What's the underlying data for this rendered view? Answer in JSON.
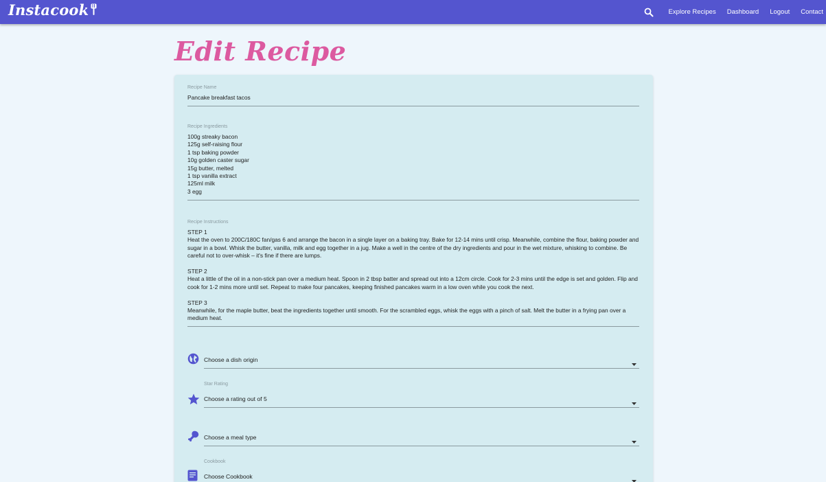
{
  "nav": {
    "brand": "Instacook",
    "links": [
      "Explore Recipes",
      "Dashboard",
      "Logout",
      "Contact"
    ]
  },
  "page": {
    "title": "Edit Recipe"
  },
  "form": {
    "name": {
      "label": "Recipe Name",
      "value": "Pancake breakfast tacos"
    },
    "ingredients": {
      "label": "Recipe Ingredients",
      "value": "100g streaky bacon\n125g self-raising flour\n1 tsp baking powder\n10g golden caster sugar\n15g butter, melted\n1 tsp vanilla extract\n125ml milk\n3 egg"
    },
    "instructions": {
      "label": "Recipe Instructions",
      "value": "STEP 1\nHeat the oven to 200C/180C fan/gas 6 and arrange the bacon in a single layer on a baking tray. Bake for 12-14 mins until crisp. Meanwhile, combine the flour, baking powder and sugar in a bowl. Whisk the butter, vanilla, milk and egg together in a jug. Make a well in the centre of the dry ingredients and pour in the wet mixture, whisking to combine. Be careful not to over-whisk – it's fine if there are lumps.\n\nSTEP 2\nHeat a little of the oil in a non-stick pan over a medium heat. Spoon in 2 tbsp batter and spread out into a 12cm circle. Cook for 2-3 mins until the edge is set and golden. Flip and cook for 1-2 mins more until set. Repeat to make four pancakes, keeping finished pancakes warm in a low oven while you cook the next.\n\nSTEP 3\nMeanwhile, for the maple butter, beat the ingredients together until smooth. For the scrambled eggs, whisk the eggs with a pinch of salt. Melt the butter in a frying pan over a medium heat."
    },
    "origin": {
      "label": "",
      "placeholder": "Choose a dish origin",
      "icon": "globe-icon"
    },
    "rating": {
      "label": "Star Rating",
      "placeholder": "Choose a rating out of 5",
      "icon": "star-icon"
    },
    "meal": {
      "label": "",
      "placeholder": "Choose a meal type",
      "icon": "drumstick-icon"
    },
    "cookbook": {
      "label": "Cookbook",
      "placeholder": "Choose Cookbook",
      "icon": "book-icon"
    }
  },
  "colors": {
    "nav": "#5455cf",
    "accent": "#dc5aa0",
    "card": "#d5ecf1",
    "icon": "#5455cf",
    "background": "#eef6fc"
  }
}
